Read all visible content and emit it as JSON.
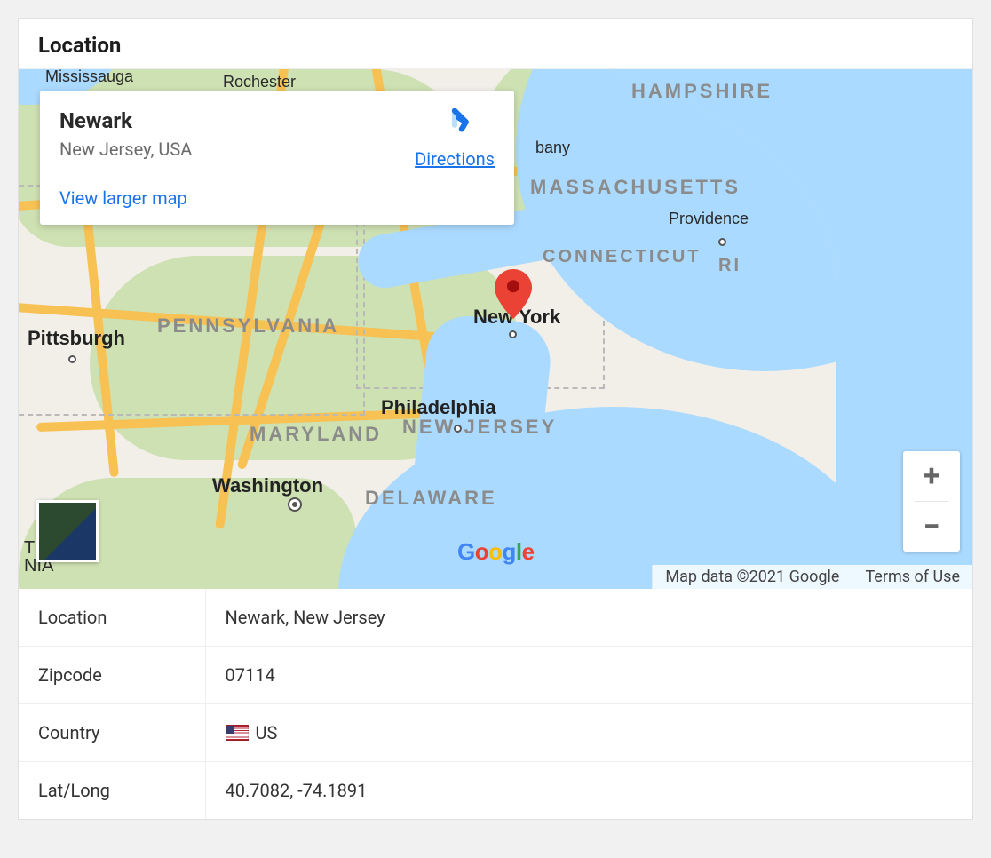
{
  "card": {
    "title": "Location"
  },
  "infoWindow": {
    "placeName": "Newark",
    "placeRegion": "New Jersey, USA",
    "directionsLabel": "Directions",
    "viewLargerLabel": "View larger map"
  },
  "mapLabels": {
    "mississauga": "Mississauga",
    "rochester": "Rochester",
    "hampshire": "HAMPSHIRE",
    "bany": "bany",
    "massachusetts": "MASSACHUSETTS",
    "providence": "Providence",
    "connecticut": "CONNECTICUT",
    "ri": "RI",
    "pennsylvania": "PENNSYLVANIA",
    "pittsburgh": "Pittsburgh",
    "newyork": "New York",
    "philadelphia": "Philadelphia",
    "newjersey": "NEW JERSEY",
    "maryland": "MARYLAND",
    "washington": "Washington",
    "delaware": "DELAWARE",
    "tFragment": "T",
    "niaFragment": "NIA"
  },
  "attribution": {
    "mapData": "Map data ©2021 Google",
    "terms": "Terms of Use"
  },
  "zoom": {
    "plus": "+",
    "minus": "−"
  },
  "logo": {
    "g1": "G",
    "g2": "o",
    "g3": "o",
    "g4": "g",
    "g5": "l",
    "g6": "e"
  },
  "table": {
    "locationLabel": "Location",
    "locationValue": "Newark, New Jersey",
    "zipLabel": "Zipcode",
    "zipValue": "07114",
    "countryLabel": "Country",
    "countryValue": "US",
    "latlongLabel": "Lat/Long",
    "latlongValue": "40.7082, -74.1891"
  }
}
